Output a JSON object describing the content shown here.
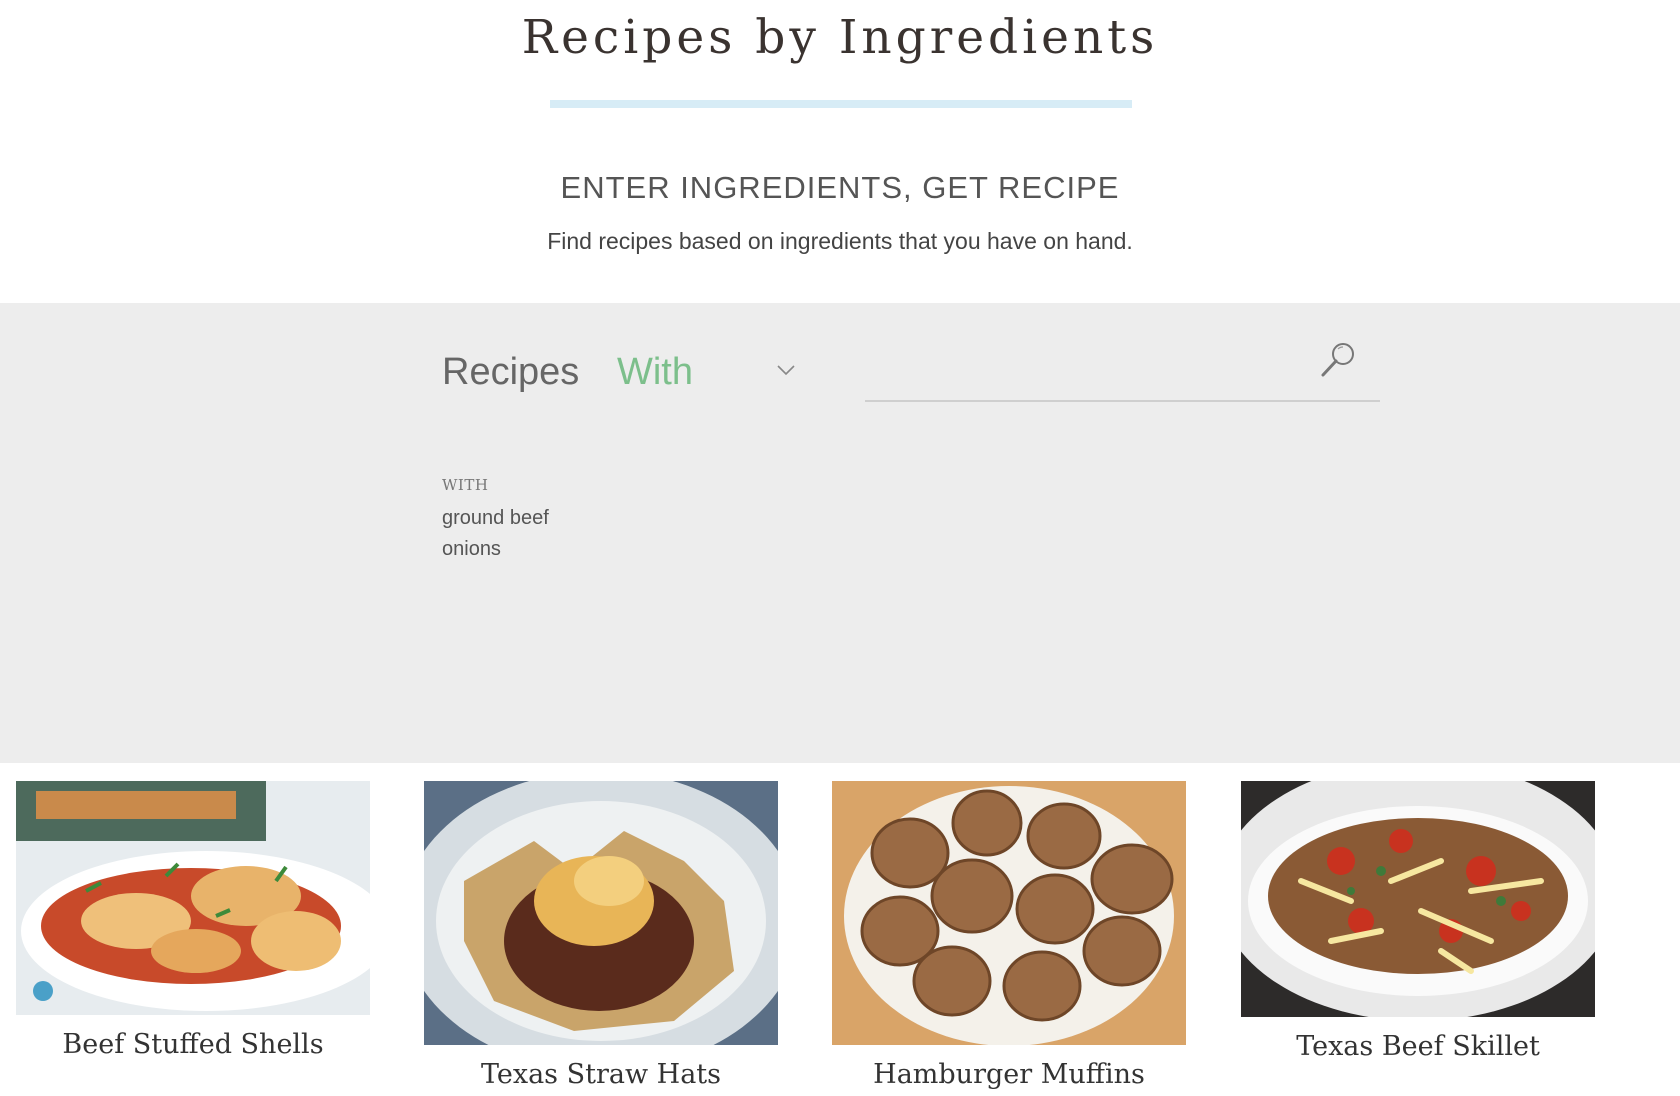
{
  "header": {
    "title": "Recipes by Ingredients",
    "section_heading": "ENTER INGREDIENTS, GET RECIPE",
    "section_subtext": "Find recipes based on ingredients that you have on hand."
  },
  "search": {
    "recipes_label": "Recipes",
    "mode": "With",
    "query": "",
    "placeholder": "",
    "with_label": "WITH",
    "ingredients": [
      "ground beef",
      "onions"
    ]
  },
  "results": [
    {
      "title": "Beef Stuffed Shells",
      "image": "stuffed-shells-photo"
    },
    {
      "title": "Texas Straw Hats",
      "image": "straw-hats-photo"
    },
    {
      "title": "Hamburger Muffins",
      "image": "hamburger-muffins-photo"
    },
    {
      "title": "Texas Beef Skillet",
      "image": "beef-skillet-photo"
    }
  ],
  "colors": {
    "accent_green": "#7cbf8b",
    "underline_blue": "#d7ecf6",
    "band_gray": "#ededed"
  }
}
